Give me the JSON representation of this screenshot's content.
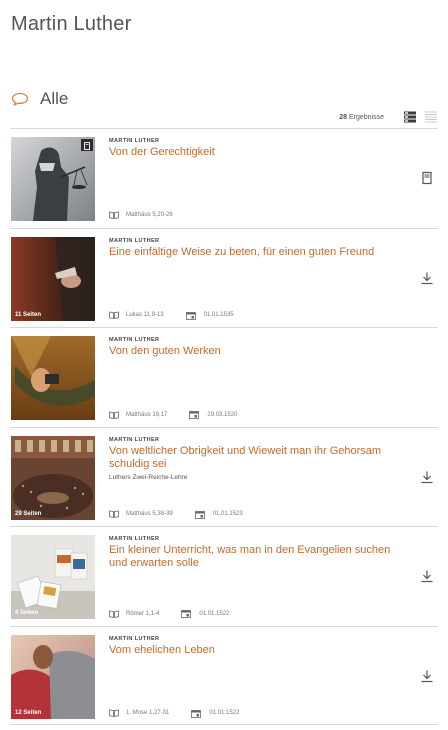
{
  "header": {
    "title": "Martin Luther"
  },
  "filter": {
    "icon": "speech-bubble-icon",
    "label": "Alle"
  },
  "toolbar": {
    "count": "28",
    "count_label": "Ergebnisse"
  },
  "items": [
    {
      "kicker": "MARTIN LUTHER",
      "title": "Von der Gerechtigkeit",
      "subtitle": "",
      "pages": "",
      "scripture": "Matthäus 5,20-26",
      "date": "",
      "action": "book-icon",
      "thumb": "justitia-statue"
    },
    {
      "kicker": "MARTIN LUTHER",
      "title": "Eine einfältige Weise zu beten, für einen guten Freund",
      "subtitle": "",
      "pages": "11 Seiten",
      "scripture": "Lukas 11,9-13",
      "date": "01.01.1535",
      "action": "download-icon",
      "thumb": "praying-hands"
    },
    {
      "kicker": "MARTIN LUTHER",
      "title": "Von den guten Werken",
      "subtitle": "",
      "pages": "",
      "scripture": "Matthäus 19,17",
      "date": "29.03.1520",
      "action": "",
      "thumb": "hammock-reader"
    },
    {
      "kicker": "MARTIN LUTHER",
      "title": "Von weltlicher Obrigkeit und Wieweit man ihr Gehorsam schuldig sei",
      "subtitle": "Luthers Zwei-Reiche-Lehre",
      "pages": "29 Seiten",
      "scripture": "Matthäus 5,38-39",
      "date": "01.01.1523",
      "action": "download-icon",
      "thumb": "parliament"
    },
    {
      "kicker": "MARTIN LUTHER",
      "title": "Ein kleiner Unterricht, was man in den Evangelien suchen und erwarten solle",
      "subtitle": "",
      "pages": "4 Seiten",
      "scripture": "Römer 1,1-4",
      "date": "01.01.1522",
      "action": "download-icon",
      "thumb": "booklets"
    },
    {
      "kicker": "MARTIN LUTHER",
      "title": "Vom ehelichen Leben",
      "subtitle": "",
      "pages": "12 Seiten",
      "scripture": "1. Mose 1,27-31",
      "date": "01.01.1522",
      "action": "download-icon",
      "thumb": "couple"
    }
  ],
  "colors": {
    "accent": "#c56a2a",
    "text": "#555555",
    "divider": "#d8d8d8"
  }
}
